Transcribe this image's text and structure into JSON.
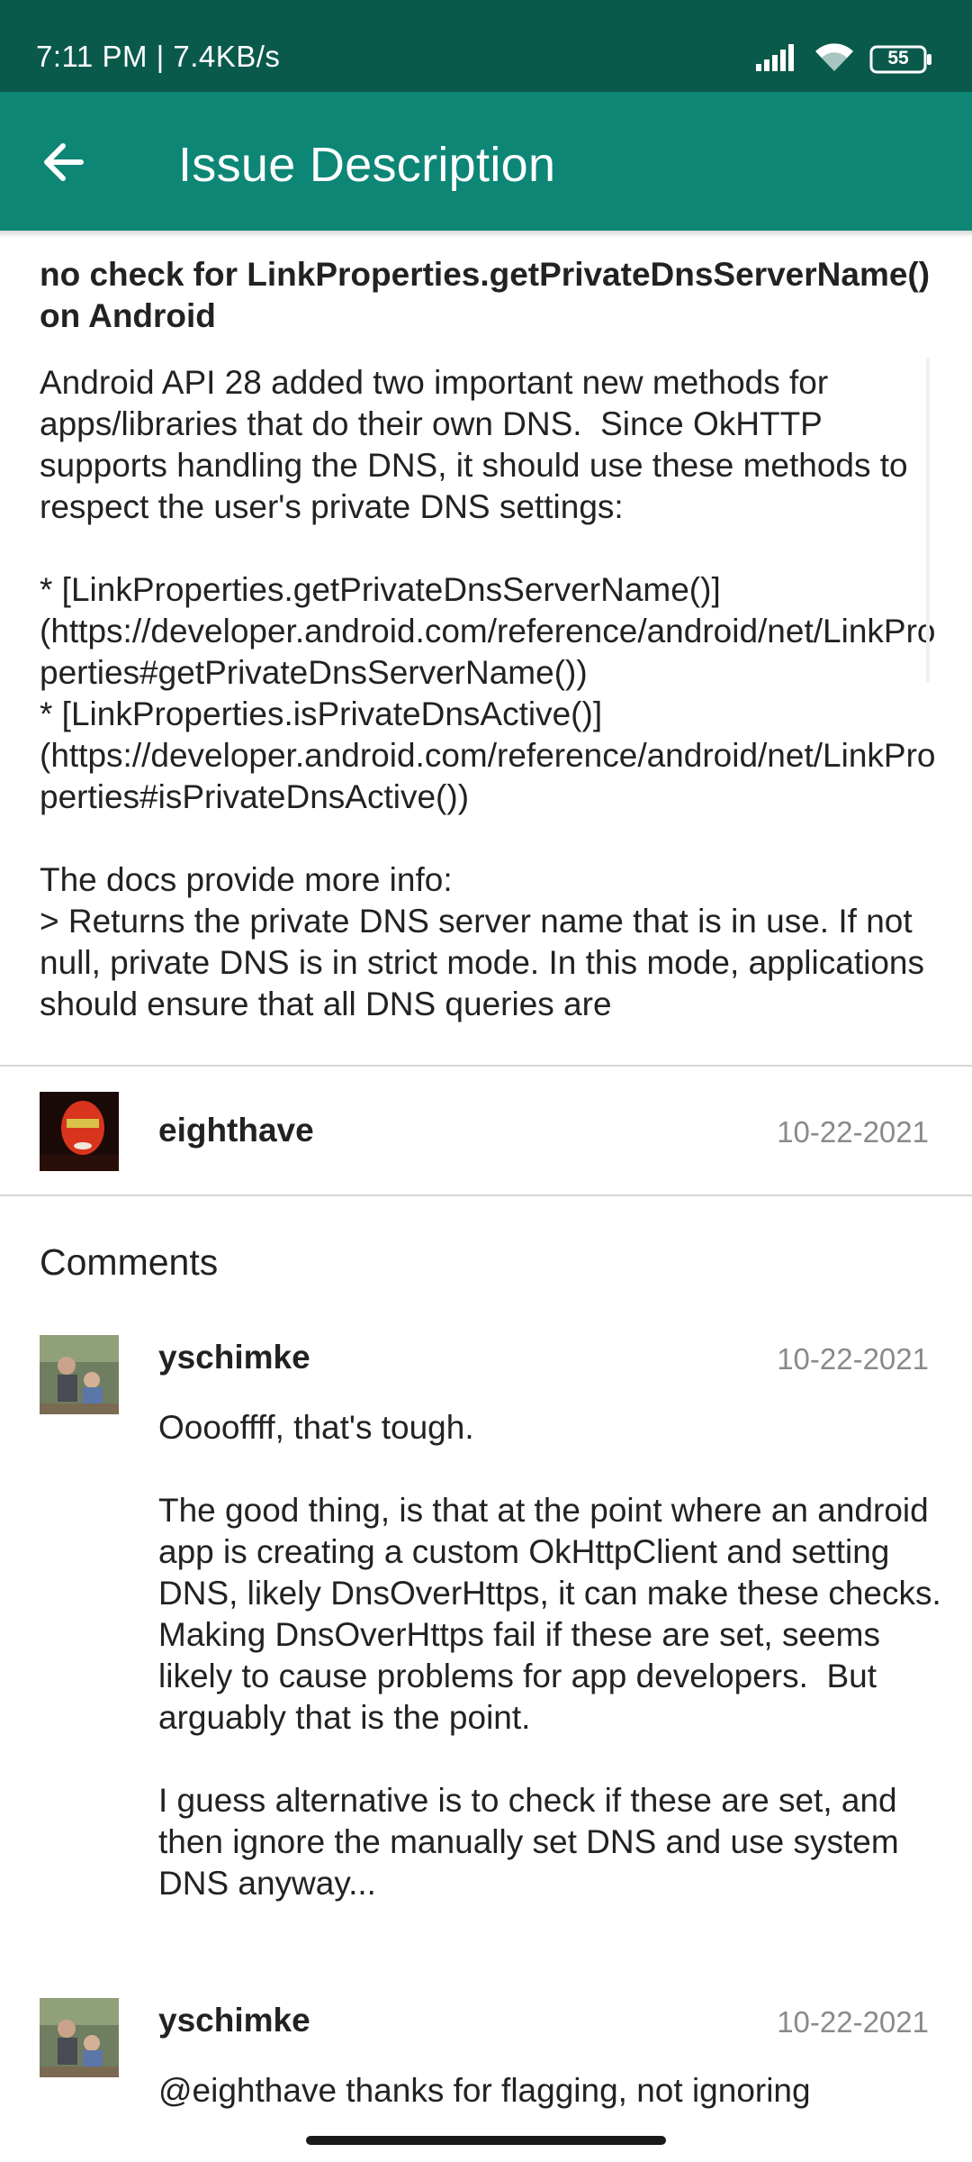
{
  "status_bar": {
    "text": "7:11 PM | 7.4KB/s",
    "battery": "55"
  },
  "app_bar": {
    "title": "Issue Description"
  },
  "issue": {
    "title": "no check for LinkProperties.getPrivateDnsServerName() on Android",
    "body": "Android API 28 added two important new methods for apps/libraries that do their own DNS.  Since OkHTTP supports handling the DNS, it should use these methods to respect the user's private DNS settings:\n\n* [LinkProperties.getPrivateDnsServerName()](https://developer.android.com/reference/android/net/LinkProperties#getPrivateDnsServerName())\n* [LinkProperties.isPrivateDnsActive()](https://developer.android.com/reference/android/net/LinkProperties#isPrivateDnsActive())\n\nThe docs provide more info:\n> Returns the private DNS server name that is in use. If not null, private DNS is in strict mode. In this mode, applications should ensure that all DNS queries are",
    "author": "eighthave",
    "date": "10-22-2021"
  },
  "comments": {
    "heading": "Comments",
    "items": [
      {
        "author": "yschimke",
        "date": "10-22-2021",
        "body": "Ooooffff, that's tough.\n\nThe good thing, is that at the point where an android app is creating a custom OkHttpClient and setting DNS, likely DnsOverHttps, it can make these checks.  Making DnsOverHttps fail if these are set, seems likely to cause problems for app developers.  But arguably that is the point.\n\nI guess alternative is to check if these are set, and then ignore the manually set DNS and use system DNS anyway..."
      },
      {
        "author": "yschimke",
        "date": "10-22-2021",
        "body": "@eighthave thanks for flagging, not ignoring"
      }
    ]
  },
  "colors": {
    "status_bar": "#0a5a4c",
    "app_bar": "#0d8676",
    "date_text": "#8a8a8a"
  },
  "icons": [
    "back-arrow-icon",
    "signal-icon",
    "wifi-icon",
    "battery-icon"
  ]
}
